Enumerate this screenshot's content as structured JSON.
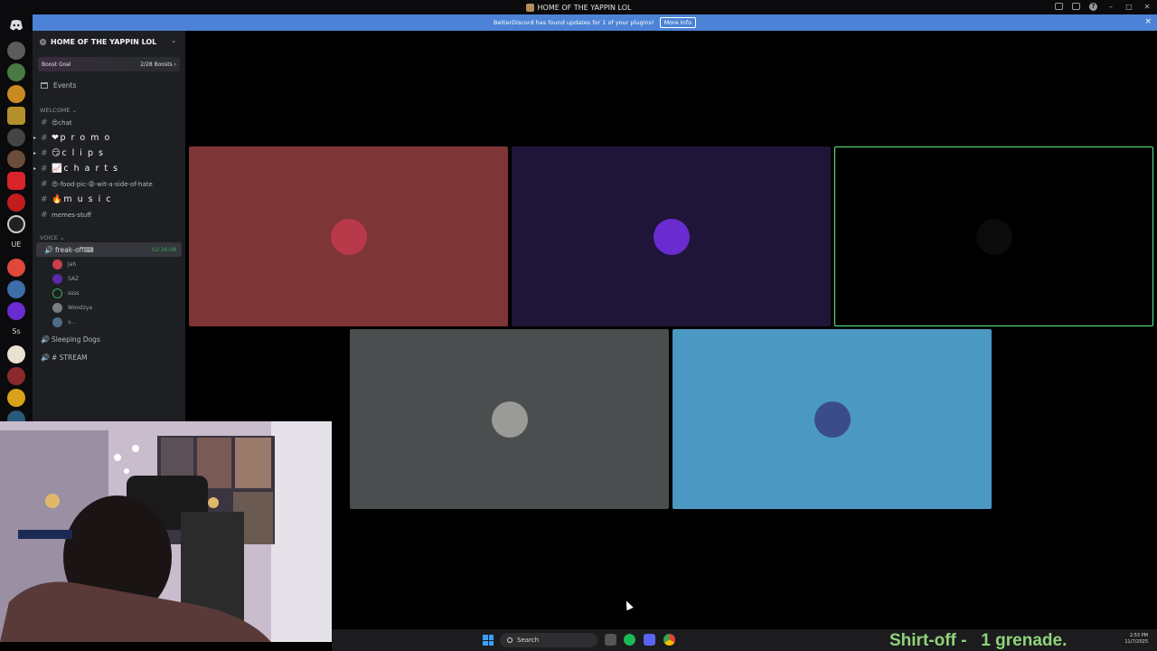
{
  "window": {
    "title": "HOME OF THE YAPPIN LOL"
  },
  "notice": {
    "text": "BetterDiscord has found updates for 1 of your plugins!",
    "button": "More Info",
    "close": "×"
  },
  "sidebar": {
    "server_name": "HOME OF THE YAPPIN LOL",
    "boost": {
      "label": "Boost Goal",
      "count": "2/28 Boosts ›"
    },
    "events_label": "Events",
    "welcome_category": "WELCOME ⌄",
    "text_channels": [
      {
        "name": "😍chat",
        "big": false
      },
      {
        "name": "❤p r o m o",
        "big": true
      },
      {
        "name": "😏c l i p s",
        "big": true
      },
      {
        "name": "📈c h a r t s",
        "big": true
      },
      {
        "name": "😍-food-pic-😡-wit-a-side-of-hate",
        "big": false
      },
      {
        "name": "🔥m u s i c",
        "big": true
      },
      {
        "name": "memes-stuff",
        "big": false
      }
    ],
    "voice_category": "VOICE ⌄",
    "active_voice": {
      "name": "freak-off⌨",
      "time": "02:26:08"
    },
    "voice_users": [
      {
        "name": "Jah",
        "color": "#c9424b"
      },
      {
        "name": "SAZ",
        "color": "#5a2aa8"
      },
      {
        "name": "ssss",
        "color": "ring"
      },
      {
        "name": "Woodzya",
        "color": "#7a7d80"
      },
      {
        "name": "v...",
        "color": "#4d6b8a"
      }
    ],
    "other_voice": [
      {
        "name": "Sleeping Dogs"
      },
      {
        "name": "# STREAM"
      }
    ]
  },
  "tiles": [
    {
      "name": "tile-user-1",
      "bg": "#7d3535",
      "avatar": "#b8394a"
    },
    {
      "name": "tile-user-2",
      "bg": "#1f1538",
      "avatar": "#6a2bd0"
    },
    {
      "name": "tile-user-3",
      "bg": "#000000",
      "avatar": "#0b0b0b",
      "speaking": true
    },
    {
      "name": "tile-user-4",
      "bg": "#4b4e4e",
      "avatar": "#9a9a96"
    },
    {
      "name": "tile-user-5",
      "bg": "#4b98c3",
      "avatar": "#3a4d8a"
    }
  ],
  "taskbar": {
    "search_placeholder": "Search",
    "overlay_text": "Shirt-off -   1 grenade.",
    "time": "2:53 PM",
    "date": "11/7/2025"
  }
}
